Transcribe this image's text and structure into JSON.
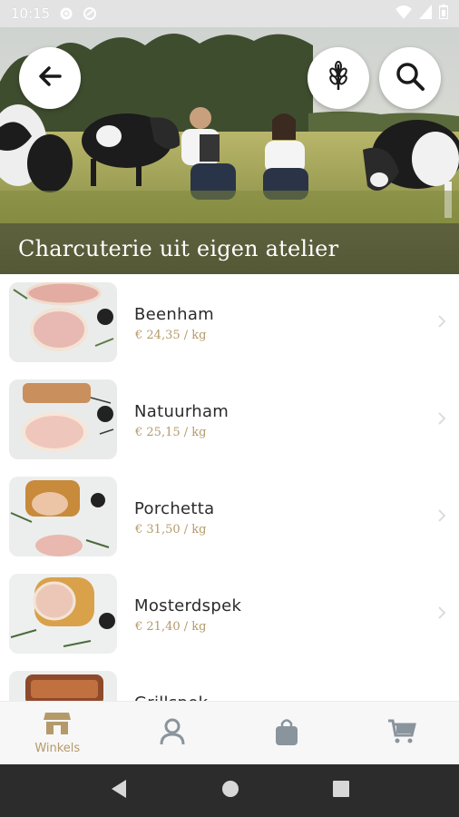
{
  "status": {
    "time": "10:15"
  },
  "hero": {
    "title": "Charcuterie uit eigen atelier"
  },
  "products": [
    {
      "name": "Beenham",
      "price": "€ 24,35 / kg"
    },
    {
      "name": "Natuurham",
      "price": "€ 25,15 / kg"
    },
    {
      "name": "Porchetta",
      "price": "€ 31,50 / kg"
    },
    {
      "name": "Mosterdspek",
      "price": "€ 21,40 / kg"
    },
    {
      "name": "Grillspek",
      "price": ""
    }
  ],
  "nav": {
    "shops_label": "Winkels",
    "accent_color": "#b49a6a",
    "icon_color": "#8a949c"
  }
}
